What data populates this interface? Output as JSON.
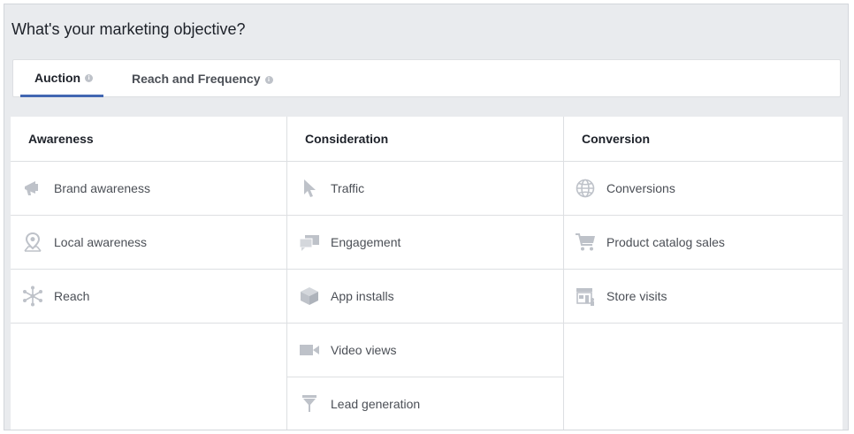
{
  "page": {
    "title": "What's your marketing objective?"
  },
  "tabs": [
    {
      "label": "Auction",
      "info": "i",
      "selected": true
    },
    {
      "label": "Reach and Frequency",
      "info": "i",
      "selected": false
    }
  ],
  "columns": [
    {
      "header": "Awareness",
      "items": [
        {
          "label": "Brand awareness",
          "icon": "megaphone-icon"
        },
        {
          "label": "Local awareness",
          "icon": "location-pin-icon"
        },
        {
          "label": "Reach",
          "icon": "asterisk-network-icon"
        }
      ]
    },
    {
      "header": "Consideration",
      "items": [
        {
          "label": "Traffic",
          "icon": "cursor-icon"
        },
        {
          "label": "Engagement",
          "icon": "chat-bubbles-icon"
        },
        {
          "label": "App installs",
          "icon": "box-icon"
        },
        {
          "label": "Video views",
          "icon": "video-camera-icon"
        },
        {
          "label": "Lead generation",
          "icon": "funnel-icon"
        }
      ]
    },
    {
      "header": "Conversion",
      "items": [
        {
          "label": "Conversions",
          "icon": "globe-icon"
        },
        {
          "label": "Product catalog sales",
          "icon": "shopping-cart-icon"
        },
        {
          "label": "Store visits",
          "icon": "storefront-icon"
        }
      ]
    }
  ],
  "colors": {
    "accent": "#4267b2",
    "icon": "#bec2c9",
    "text": "#4b4f56",
    "background": "#e9ebee"
  }
}
